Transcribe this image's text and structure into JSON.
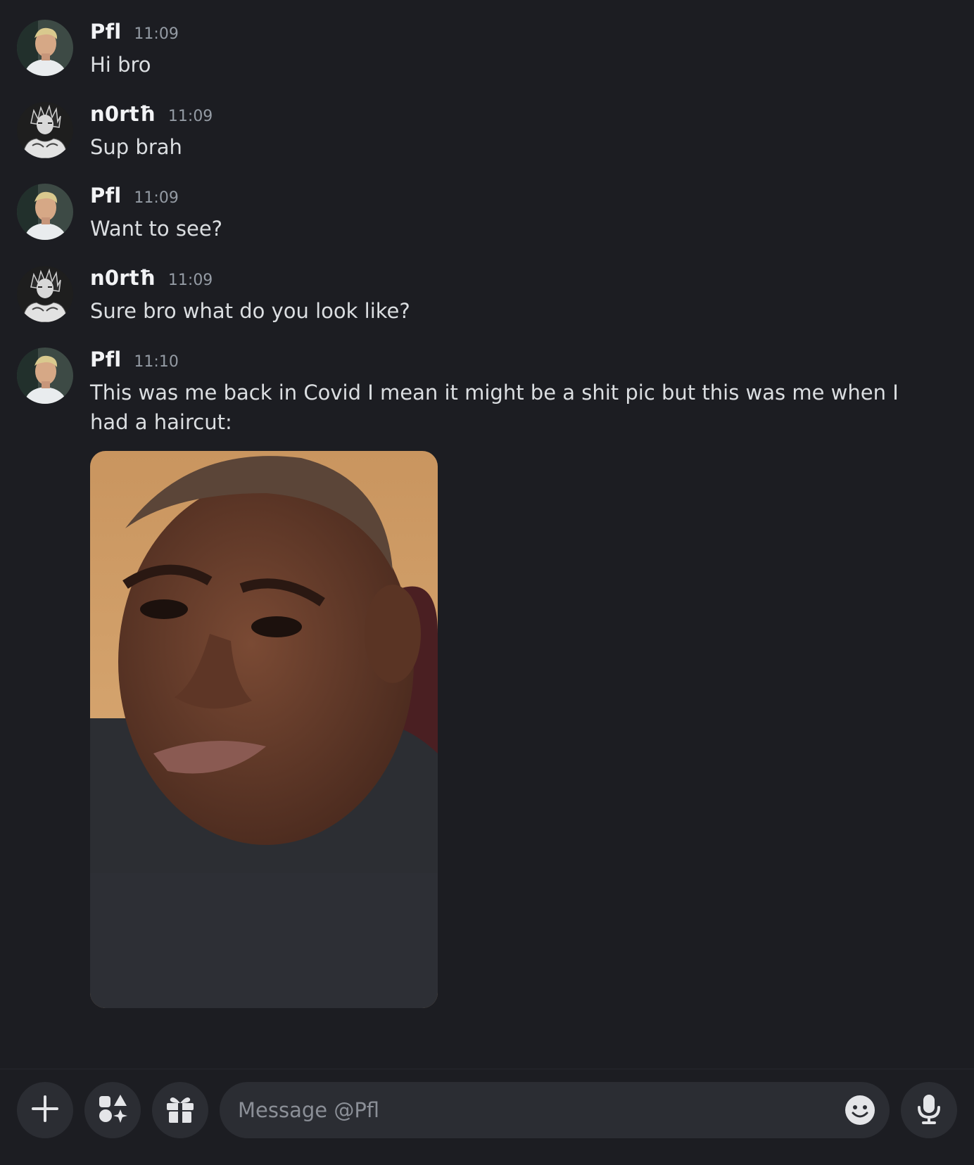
{
  "colors": {
    "background": "#1c1d22",
    "author": "#f2f3f5",
    "timestamp": "#949ba4",
    "message_text": "#dbdee1",
    "composer_bg": "#2b2d33"
  },
  "messages": [
    {
      "author": "Pfl",
      "time": "11:09",
      "text": "Hi bro",
      "avatar_icon": "pfl-avatar"
    },
    {
      "author": "n0rtħ",
      "time": "11:09",
      "text": "Sup brah",
      "avatar_icon": "north-avatar"
    },
    {
      "author": "Pfl",
      "time": "11:09",
      "text": "Want to see?",
      "avatar_icon": "pfl-avatar"
    },
    {
      "author": "n0rtħ",
      "time": "11:09",
      "text": "Sure bro what do you look like?",
      "avatar_icon": "north-avatar"
    },
    {
      "author": "Pfl",
      "time": "11:10",
      "text": "This was me back in Covid I mean it might be a shit pic but this was me when I had a haircut:",
      "avatar_icon": "pfl-avatar",
      "attachment": "photo-attachment"
    }
  ],
  "composer": {
    "placeholder": "Message @Pfl",
    "buttons": [
      "plus-icon",
      "apps-icon",
      "gift-icon",
      "emoji-icon",
      "microphone-icon"
    ]
  }
}
